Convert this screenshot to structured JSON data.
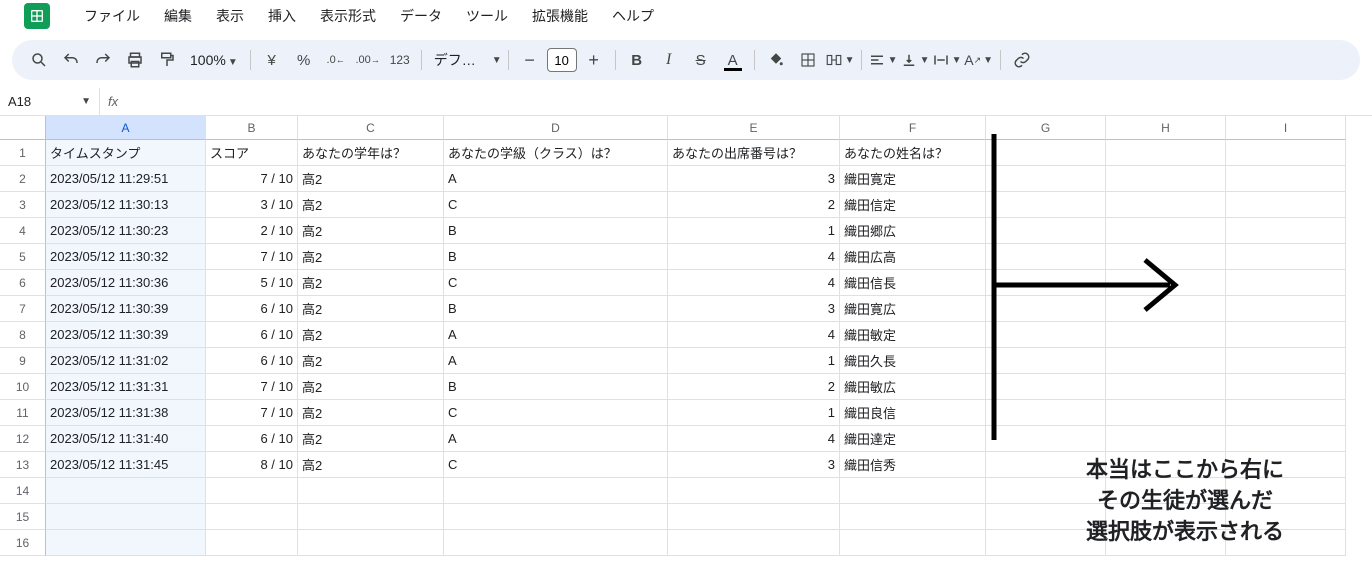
{
  "menu": {
    "items": [
      "ファイル",
      "編集",
      "表示",
      "挿入",
      "表示形式",
      "データ",
      "ツール",
      "拡張機能",
      "ヘルプ"
    ]
  },
  "toolbar": {
    "zoom": "100%",
    "currency": "¥",
    "percent": "%",
    "dec_dec": ".0",
    "inc_dec": ".00",
    "num_fmt": "123",
    "font": "デフォ...",
    "font_size": "10"
  },
  "namebox": "A18",
  "fx": "fx",
  "columns": [
    "A",
    "B",
    "C",
    "D",
    "E",
    "F",
    "G",
    "H",
    "I"
  ],
  "col_widths": [
    "cA",
    "cB",
    "cC",
    "cD",
    "cE",
    "cF",
    "cG",
    "cH",
    "cI"
  ],
  "selected_col": 0,
  "headers": [
    "タイムスタンプ",
    "スコア",
    "あなたの学年は？",
    "あなたの学級（クラス）は？",
    "あなたの出席番号は？",
    "あなたの姓名は？",
    "",
    "",
    ""
  ],
  "rows": [
    [
      "2023/05/12 11:29:51",
      "7 / 10",
      "高2",
      "A",
      "3",
      "織田寛定",
      "",
      "",
      ""
    ],
    [
      "2023/05/12 11:30:13",
      "3 / 10",
      "高2",
      "C",
      "2",
      "織田信定",
      "",
      "",
      ""
    ],
    [
      "2023/05/12 11:30:23",
      "2 / 10",
      "高2",
      "B",
      "1",
      "織田郷広",
      "",
      "",
      ""
    ],
    [
      "2023/05/12 11:30:32",
      "7 / 10",
      "高2",
      "B",
      "4",
      "織田広高",
      "",
      "",
      ""
    ],
    [
      "2023/05/12 11:30:36",
      "5 / 10",
      "高2",
      "C",
      "4",
      "織田信長",
      "",
      "",
      ""
    ],
    [
      "2023/05/12 11:30:39",
      "6 / 10",
      "高2",
      "B",
      "3",
      "織田寛広",
      "",
      "",
      ""
    ],
    [
      "2023/05/12 11:30:39",
      "6 / 10",
      "高2",
      "A",
      "4",
      "織田敏定",
      "",
      "",
      ""
    ],
    [
      "2023/05/12 11:31:02",
      "6 / 10",
      "高2",
      "A",
      "1",
      "織田久長",
      "",
      "",
      ""
    ],
    [
      "2023/05/12 11:31:31",
      "7 / 10",
      "高2",
      "B",
      "2",
      "織田敏広",
      "",
      "",
      ""
    ],
    [
      "2023/05/12 11:31:38",
      "7 / 10",
      "高2",
      "C",
      "1",
      "織田良信",
      "",
      "",
      ""
    ],
    [
      "2023/05/12 11:31:40",
      "6 / 10",
      "高2",
      "A",
      "4",
      "織田達定",
      "",
      "",
      ""
    ],
    [
      "2023/05/12 11:31:45",
      "8 / 10",
      "高2",
      "C",
      "3",
      "織田信秀",
      "",
      "",
      ""
    ]
  ],
  "numeric_cols": [
    1,
    4
  ],
  "total_rows": 16,
  "active_row": 18,
  "annotation": {
    "text": "本当はここから右に\nその生徒が選んだ\n選択肢が表示される"
  }
}
